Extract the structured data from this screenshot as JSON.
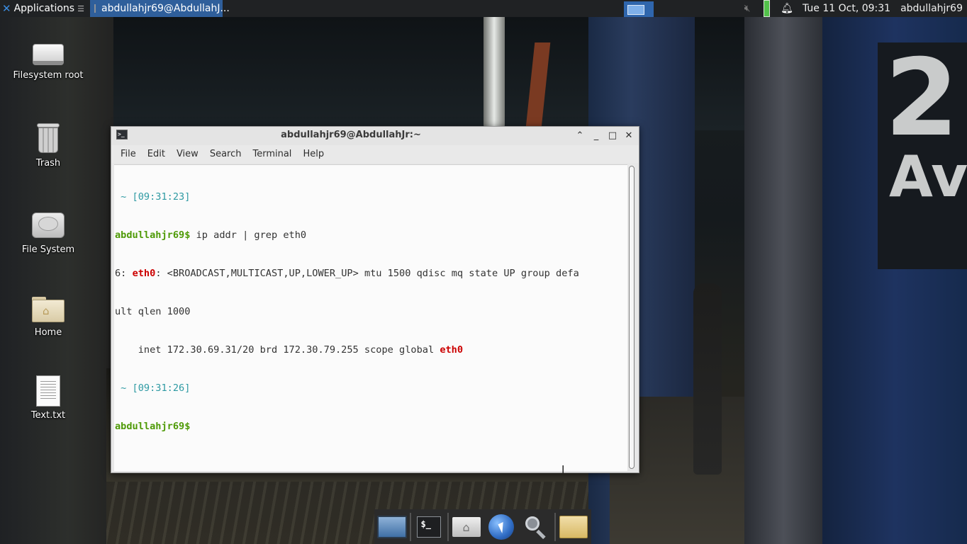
{
  "panel": {
    "apps_label": "Applications",
    "task_label": "abdullahjr69@AbdullahJ...",
    "clock": "Tue 11 Oct, 09:31",
    "user": "abdullahjr69"
  },
  "desktop_icons": [
    {
      "label": "Filesystem root",
      "icon": "drive-icon"
    },
    {
      "label": "Trash",
      "icon": "trash-icon"
    },
    {
      "label": "File System",
      "icon": "hard-disk-icon"
    },
    {
      "label": "Home",
      "icon": "home-folder-icon"
    },
    {
      "label": "Text.txt",
      "icon": "text-file-icon"
    }
  ],
  "terminal": {
    "title": "abdullahjr69@AbdullahJr:~",
    "menu": [
      "File",
      "Edit",
      "View",
      "Search",
      "Terminal",
      "Help"
    ],
    "lines": {
      "l1_time": " ~ [09:31:23]",
      "l2_prompt": "abdullahjr69$",
      "l2_cmd": " ip addr | grep eth0",
      "l3_num": "6: ",
      "l3_iface": "eth0",
      "l3_rest": ": <BROADCAST,MULTICAST,UP,LOWER_UP> mtu 1500 qdisc mq state UP group defa",
      "l4": "ult qlen 1000",
      "l5_pre": "    inet 172.30.69.31/20 brd 172.30.79.255 scope global ",
      "l5_iface": "eth0",
      "l6_time": " ~ [09:31:26]",
      "l7_prompt": "abdullahjr69$"
    }
  },
  "wallpaper": {
    "sign_number": "2",
    "sign_text": "Ave"
  },
  "dock": [
    "desktop-icon",
    "terminal-icon",
    "home-folder-icon",
    "web-browser-icon",
    "search-icon",
    "file-manager-icon"
  ],
  "colors": {
    "panel_bg": "#202224",
    "task_active": "#2f5f9b",
    "prompt_green": "#4e9a06",
    "time_teal": "#2e9aa3",
    "iface_red": "#cc0000"
  }
}
